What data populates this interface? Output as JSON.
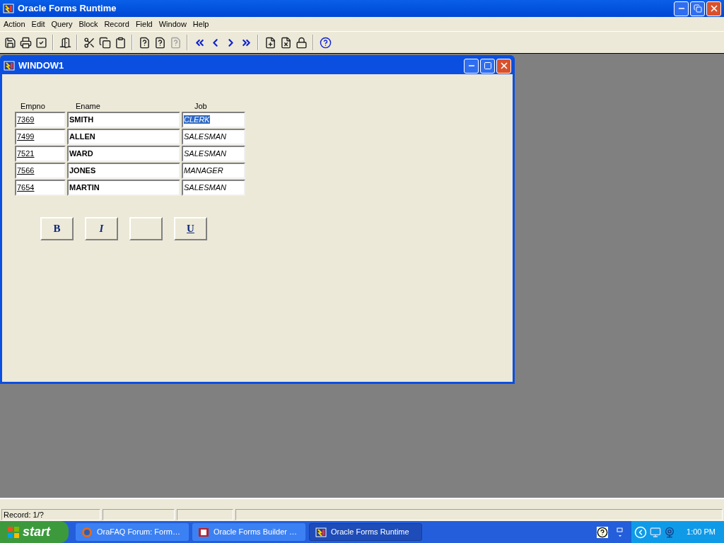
{
  "app_window": {
    "title": "Oracle Forms Runtime"
  },
  "menu": [
    "Action",
    "Edit",
    "Query",
    "Block",
    "Record",
    "Field",
    "Window",
    "Help"
  ],
  "form_window": {
    "title": "WINDOW1"
  },
  "columns": [
    "Empno",
    "Ename",
    "Job"
  ],
  "rows": [
    {
      "empno": "7369",
      "ename": "SMITH",
      "job": "CLERK",
      "selected": true
    },
    {
      "empno": "7499",
      "ename": "ALLEN",
      "job": "SALESMAN",
      "selected": false
    },
    {
      "empno": "7521",
      "ename": "WARD",
      "job": "SALESMAN",
      "selected": false
    },
    {
      "empno": "7566",
      "ename": "JONES",
      "job": "MANAGER",
      "selected": false
    },
    {
      "empno": "7654",
      "ename": "MARTIN",
      "job": "SALESMAN",
      "selected": false
    }
  ],
  "buttons": [
    {
      "kind": "bold",
      "label": "B"
    },
    {
      "kind": "italic",
      "label": "I"
    },
    {
      "kind": "blank"
    },
    {
      "kind": "underline",
      "label": "U"
    }
  ],
  "status_bar": [
    "Record: 1/?"
  ],
  "taskbar": {
    "start": "start",
    "tasks": [
      {
        "label": "OraFAQ Forum: Form…",
        "selected": false
      },
      {
        "label": "Oracle Forms Builder …",
        "selected": false
      },
      {
        "label": "Oracle Forms Runtime",
        "selected": true
      }
    ],
    "clock": "1:00 PM"
  }
}
